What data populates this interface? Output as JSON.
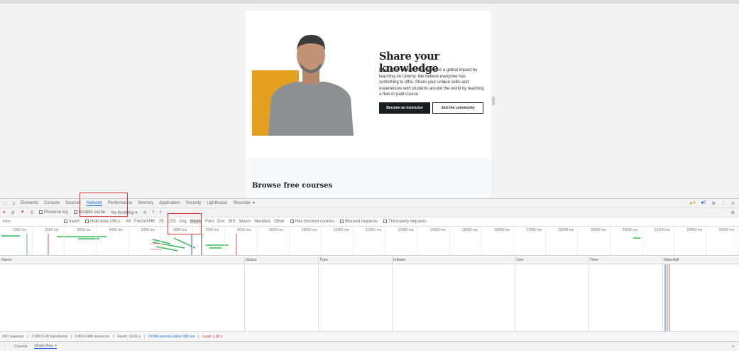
{
  "hero": {
    "title": "Share your knowledge",
    "text": "Real-world experts like you make a global impact by teaching on Udemy. We believe everyone has something to offer. Share your unique skills and experiences with students around the world by teaching a free or paid course.",
    "primary": "Become an instructor",
    "secondary": "Join the community"
  },
  "browse": "Browse free courses",
  "devtools": {
    "tabs": [
      "Elements",
      "Console",
      "Sources",
      "Network",
      "Performance",
      "Memory",
      "Application",
      "Security",
      "Lighthouse",
      "Recorder ⏶"
    ],
    "warnings": "4",
    "messages": "7",
    "toolbar": {
      "preserve_log": "Preserve log",
      "disable_cache": "Disable cache",
      "throttling": "No throttling"
    },
    "filter_placeholder": "Filter",
    "filters": {
      "invert": "Invert",
      "hide_data": "Hide data URLs",
      "types": [
        "All",
        "Fetch/XHR",
        "JS",
        "CSS",
        "Img",
        "Media",
        "Font",
        "Doc",
        "WS",
        "Wasm",
        "Manifest",
        "Other"
      ],
      "blocked_cookies": "Has blocked cookies",
      "blocked_requests": "Blocked requests",
      "third_party": "Third-party requests"
    },
    "ticks": [
      "1000 ms",
      "2000 ms",
      "3000 ms",
      "4000 ms",
      "5000 ms",
      "6000 ms",
      "7000 ms",
      "8000 ms",
      "9000 ms",
      "10000 ms",
      "11000 ms",
      "12000 ms",
      "13000 ms",
      "14000 ms",
      "15000 ms",
      "16000 ms",
      "17000 ms",
      "18000 ms",
      "19000 ms",
      "20000 ms",
      "21000 ms",
      "22000 ms",
      "23000 ms"
    ],
    "columns": [
      "Name",
      "Status",
      "Type",
      "Initiator",
      "Size",
      "Time",
      "Waterfall"
    ],
    "status": {
      "requests": "0/97 requests",
      "transferred": "0 B/575 kB transferred",
      "resources": "0 B/5.0 MB resources",
      "finish": "Finish: 19.91 s",
      "dcl": "DOMContentLoaded: 882 ms",
      "load": "Load: 1.38 s"
    },
    "drawer": [
      "Console",
      "What's New"
    ]
  }
}
